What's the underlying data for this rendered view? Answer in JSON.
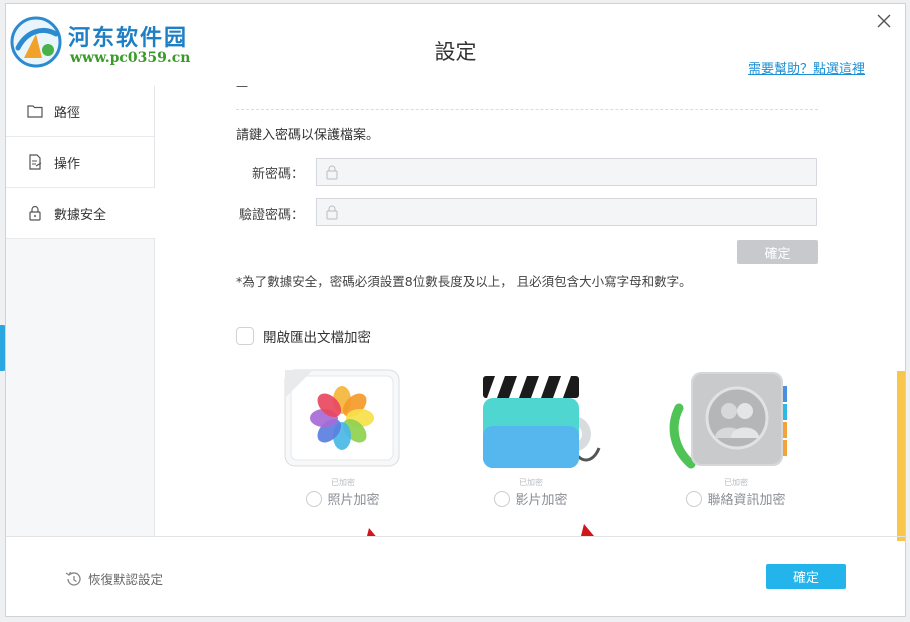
{
  "logo": {
    "text": "河东软件园",
    "url": "www.pc0359.cn"
  },
  "dialog": {
    "title": "設定",
    "help_link": "需要幫助？點選這裡"
  },
  "sidebar": {
    "items": [
      {
        "label": "路徑",
        "icon": "folder-icon"
      },
      {
        "label": "操作",
        "icon": "operation-doc-icon"
      },
      {
        "label": "數據安全",
        "icon": "lock-icon",
        "active": true
      }
    ]
  },
  "security": {
    "clipped_header": "一                 ",
    "prompt": "請鍵入密碼以保護檔案。",
    "new_password_label": "新密碼：",
    "verify_password_label": "驗證密碼：",
    "new_password_value": "",
    "verify_password_value": "",
    "confirm_button": "確定",
    "note": "*為了數據安全，密碼必須設置8位數長度及以上，  且必須包含大小寫字母和數字。",
    "export_encrypt_label": "開啟匯出文檔加密",
    "export_encrypt_checked": false
  },
  "encryption_options": [
    {
      "status": "已加密",
      "label": "照片加密",
      "icon": "photos-icon",
      "checked": false
    },
    {
      "status": "已加密",
      "label": "影片加密",
      "icon": "video-clapper-icon",
      "checked": false
    },
    {
      "status": "已加密",
      "label": "聯絡資訊加密",
      "icon": "contacts-icon",
      "checked": false
    }
  ],
  "footer": {
    "restore_label": "恢復默認設定",
    "ok_button": "確定"
  },
  "colors": {
    "accent": "#23b4ec",
    "link": "#1a8fd6",
    "disabled_button": "#c7c9cc",
    "scrollbar": "#f7c64a",
    "annotation_arrow": "#d0161b"
  }
}
